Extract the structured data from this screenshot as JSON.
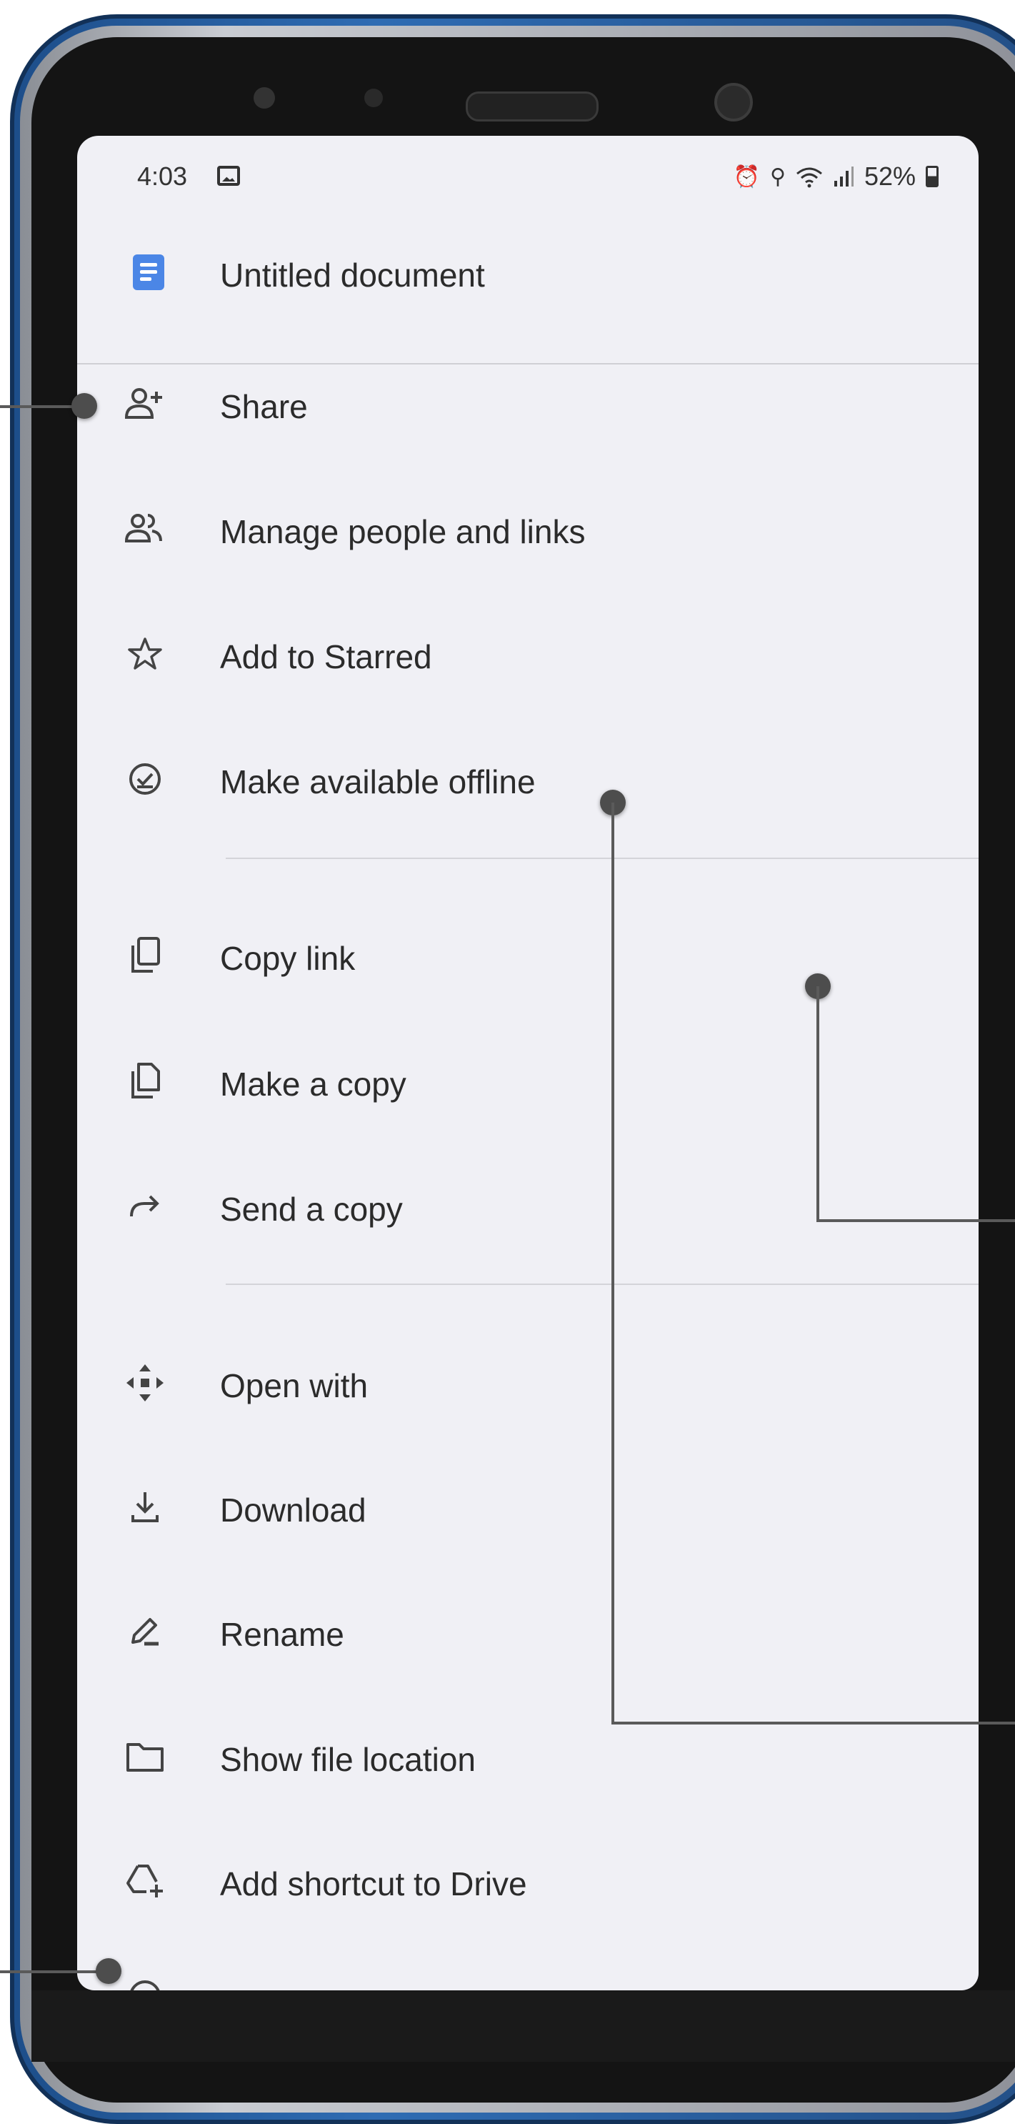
{
  "status_bar": {
    "time": "4:03",
    "battery": "52%",
    "icons": [
      "image-icon",
      "alarm-icon",
      "location-icon",
      "wifi-icon",
      "signal-icon",
      "battery-icon"
    ]
  },
  "document": {
    "title": "Untitled document",
    "icon": "docs-icon",
    "icon_color": "#4b86e6"
  },
  "menu": {
    "items": [
      {
        "label": "Share",
        "icon": "person-add-icon"
      },
      {
        "label": "Manage people and links",
        "icon": "people-icon"
      },
      {
        "label": "Add to Starred",
        "icon": "star-icon"
      },
      {
        "label": "Make available offline",
        "icon": "offline-check-icon"
      },
      {
        "label": "Copy link",
        "icon": "copy-icon"
      },
      {
        "label": "Make a copy",
        "icon": "file-copy-icon"
      },
      {
        "label": "Send a copy",
        "icon": "forward-arrow-icon"
      },
      {
        "label": "Open with",
        "icon": "open-with-icon"
      },
      {
        "label": "Download",
        "icon": "download-icon"
      },
      {
        "label": "Rename",
        "icon": "pencil-icon"
      },
      {
        "label": "Show file location",
        "icon": "folder-icon"
      },
      {
        "label": "Add shortcut to Drive",
        "icon": "drive-shortcut-icon"
      }
    ]
  },
  "colors": {
    "screen_background": "#f0f0f5",
    "phone_frame": "#2f6cb3",
    "text": "#2b2b2b",
    "callout_line": "#5a5a5a"
  }
}
